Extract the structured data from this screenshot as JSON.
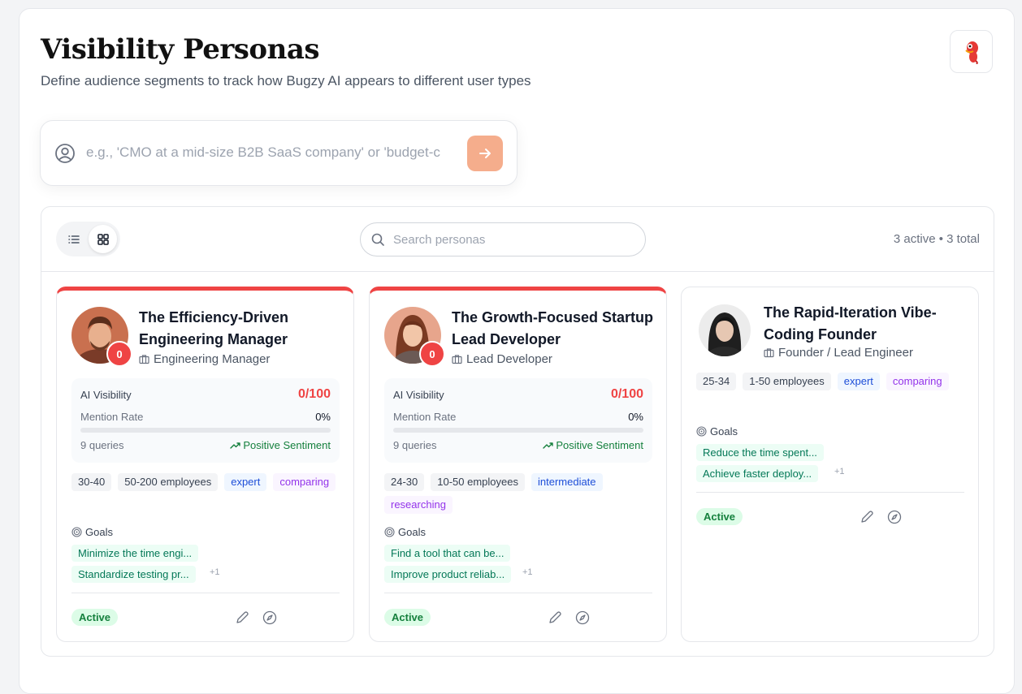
{
  "header": {
    "title": "Visibility Personas",
    "subtitle": "Define audience segments to track how Bugzy AI appears to different user types"
  },
  "prompt": {
    "placeholder": "e.g., 'CMO at a mid-size B2B SaaS company' or 'budget-c"
  },
  "toolbar": {
    "search_placeholder": "Search personas",
    "counts": "3 active • 3 total",
    "active_view": "grid"
  },
  "personas": [
    {
      "name": "The Efficiency-Driven Engineering Manager",
      "role": "Engineering Manager",
      "badge": "0",
      "visibility": {
        "label": "AI Visibility",
        "score": "0/100",
        "mention_label": "Mention Rate",
        "mention_rate": "0%",
        "mention_fraction": 0,
        "queries": "9 queries",
        "sentiment": "Positive Sentiment"
      },
      "tags": [
        {
          "text": "30-40"
        },
        {
          "text": "50-200 employees"
        },
        {
          "text": "expert"
        },
        {
          "text": "comparing"
        }
      ],
      "goals_label": "Goals",
      "goals": [
        "Minimize the time engi...",
        "Standardize testing pr..."
      ],
      "goals_more": "+1",
      "status": "Active"
    },
    {
      "name": "The Growth-Focused Startup Lead Developer",
      "role": "Lead Developer",
      "badge": "0",
      "visibility": {
        "label": "AI Visibility",
        "score": "0/100",
        "mention_label": "Mention Rate",
        "mention_rate": "0%",
        "mention_fraction": 0,
        "queries": "9 queries",
        "sentiment": "Positive Sentiment"
      },
      "tags": [
        {
          "text": "24-30"
        },
        {
          "text": "10-50 employees"
        },
        {
          "text": "intermediate"
        },
        {
          "text": "researching"
        }
      ],
      "goals_label": "Goals",
      "goals": [
        "Find a tool that can be...",
        "Improve product reliab..."
      ],
      "goals_more": "+1",
      "status": "Active"
    },
    {
      "name": "The Rapid-Iteration Vibe-Coding Founder",
      "role": "Founder / Lead Engineer",
      "tags": [
        {
          "text": "25-34"
        },
        {
          "text": "1-50 employees"
        },
        {
          "text": "expert"
        },
        {
          "text": "comparing"
        }
      ],
      "goals_label": "Goals",
      "goals": [
        "Reduce the time spent...",
        "Achieve faster deploy..."
      ],
      "goals_more": "+1",
      "status": "Active"
    }
  ],
  "colors": {
    "accent_orange": "#f5ad8c",
    "alert_red": "#ef4444",
    "active_green": "#15803d"
  }
}
